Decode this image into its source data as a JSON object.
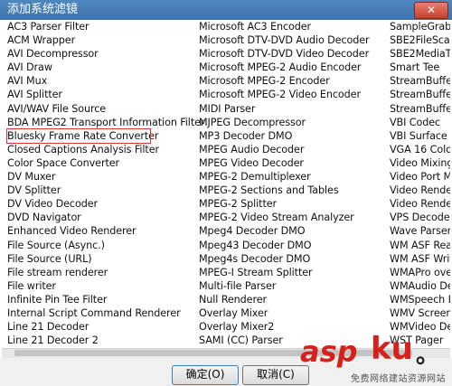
{
  "dialog": {
    "title": "添加系统滤镜",
    "close_label": "✕"
  },
  "filters": {
    "col1": [
      "AC3 Parser Filter",
      "ACM Wrapper",
      "AVI Decompressor",
      "AVI Draw",
      "AVI Mux",
      "AVI Splitter",
      "AVI/WAV File Source",
      "BDA MPEG2 Transport Information Filter",
      "Bluesky Frame Rate Converter",
      "Closed Captions Analysis Filter",
      "Color Space Converter",
      "DV Muxer",
      "DV Splitter",
      "DV Video Decoder",
      "DVD Navigator",
      "Enhanced Video Renderer",
      "File Source (Async.)",
      "File Source (URL)",
      "File stream renderer",
      "File writer",
      "Infinite Pin Tee Filter",
      "Internal Script Command Renderer",
      "Line 21 Decoder",
      "Line 21 Decoder 2"
    ],
    "col2": [
      "Microsoft AC3 Encoder",
      "Microsoft DTV-DVD Audio Decoder",
      "Microsoft DTV-DVD Video Decoder",
      "Microsoft MPEG-2 Audio Encoder",
      "Microsoft MPEG-2 Encoder",
      "Microsoft MPEG-2 Video Encoder",
      "MIDI Parser",
      "MJPEG Decompressor",
      "MP3 Decoder DMO",
      "MPEG Audio Decoder",
      "MPEG Video Decoder",
      "MPEG-2 Demultiplexer",
      "MPEG-2 Sections and Tables",
      "MPEG-2 Splitter",
      "MPEG-2 Video Stream Analyzer",
      "Mpeg4 Decoder DMO",
      "Mpeg43 Decoder DMO",
      "Mpeg4s Decoder DMO",
      "MPEG-I Stream Splitter",
      "Multi-file Parser",
      "Null Renderer",
      "Overlay Mixer",
      "Overlay Mixer2",
      "SAMI (CC) Parser"
    ],
    "col3": [
      "SampleGrabb",
      "SBE2FileScan",
      "SBE2MediaTyp",
      "Smart Tee",
      "StreamBufferS",
      "StreamBufferS",
      "StreamBufferS",
      "VBI Codec",
      "VBI Surface Al",
      "VGA 16 Color",
      "Video Mixing",
      "Video Port M",
      "Video Render",
      "Video Render",
      "VPS Decoder",
      "Wave Parser",
      "WM ASF Read",
      "WM ASF Writ",
      "WMAPro over",
      "WMAudio Dec",
      "WMSpeech D",
      "WMV Screen",
      "WMVideo Dec",
      "WST Pager"
    ],
    "highlighted": "Bluesky Frame Rate Converter"
  },
  "buttons": {
    "ok_label": "确定(O)",
    "cancel_label": "取消(C)"
  },
  "watermark": {
    "brand": "asp",
    "brand_cn": "ku",
    "brand_suffix": "。",
    "sub": "免费网络建站资源网站"
  }
}
